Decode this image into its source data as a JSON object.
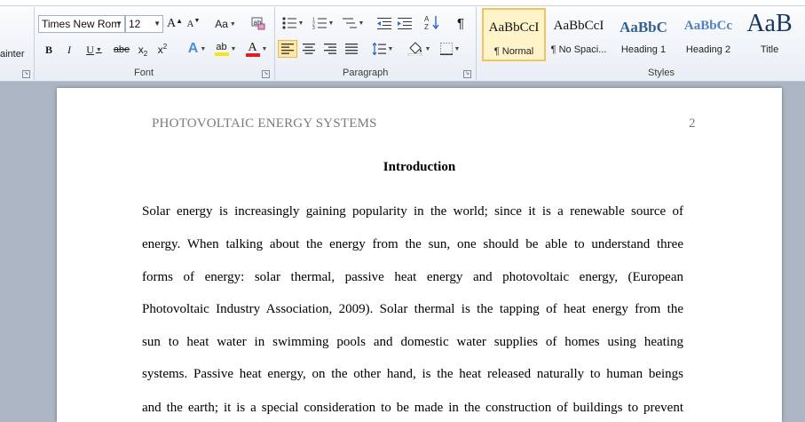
{
  "ribbon": {
    "clipboard": {
      "painter_label": "ainter"
    },
    "font": {
      "group_label": "Font",
      "font_name": "Times New Rom",
      "font_size": "12",
      "grow_label": "A",
      "shrink_label": "A",
      "change_case_label": "Aa",
      "bold_label": "B",
      "italic_label": "I",
      "underline_label": "U",
      "strike_label": "abe",
      "subscript_label": "x",
      "superscript_label": "x",
      "text_effects_label": "A",
      "highlight_label": "ab",
      "font_color_label": "A",
      "font_color": "#e02020",
      "highlight_color": "#f5e61a"
    },
    "paragraph": {
      "group_label": "Paragraph",
      "pilcrow": "¶"
    },
    "styles": {
      "group_label": "Styles",
      "items": [
        {
          "sample": "AaBbCcI",
          "name": "¶ Normal"
        },
        {
          "sample": "AaBbCcI",
          "name": "¶ No Spaci..."
        },
        {
          "sample": "AaBbC",
          "name": "Heading 1"
        },
        {
          "sample": "AaBbCc",
          "name": "Heading 2"
        },
        {
          "sample": "AaB",
          "name": "Title"
        }
      ],
      "heading_color": "#365f91"
    }
  },
  "document": {
    "running_head": "PHOTOVOLTAIC ENERGY SYSTEMS",
    "page_number": "2",
    "heading": "Introduction",
    "lines": [
      "Solar energy is increasingly gaining popularity in the world; since it is a renewable source of",
      "energy. When talking about the energy from the sun, one should be able to understand three",
      "forms of energy: solar thermal, passive heat energy and photovoltaic energy, (European",
      "Photovoltaic Industry Association, 2009). Solar thermal is the tapping of heat energy from the",
      "sun to heat water in swimming pools and domestic water supplies of homes using heating",
      "systems. Passive heat energy, on the other hand, is the heat released naturally to human beings",
      "and the earth; it is a special consideration to be made in the construction of buildings to prevent"
    ]
  }
}
